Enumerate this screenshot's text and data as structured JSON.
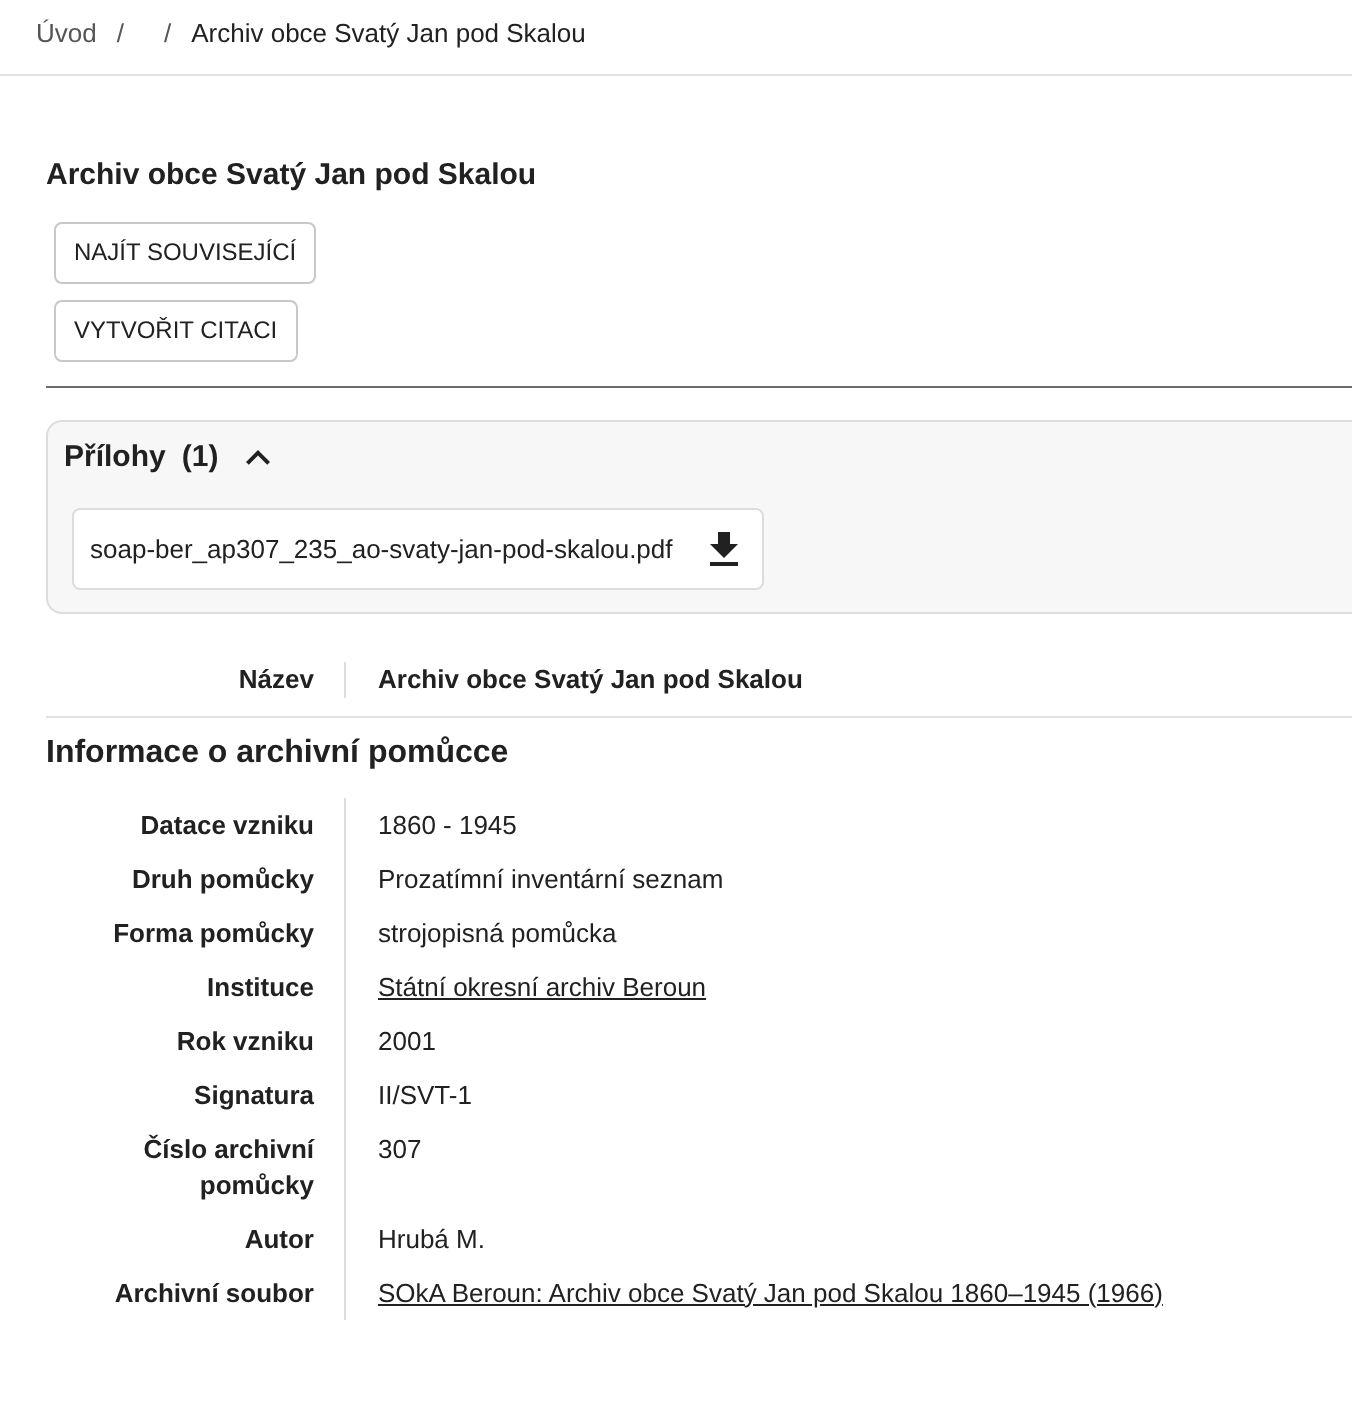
{
  "breadcrumb": [
    {
      "kind": "link",
      "text": "Úvod"
    },
    {
      "kind": "separator",
      "text": "/"
    },
    {
      "kind": "separator",
      "text": "/"
    },
    {
      "kind": "current",
      "text": "Archiv obce Svatý Jan pod Skalou"
    }
  ],
  "title": "Archiv obce Svatý Jan pod Skalou",
  "actions": [
    "NAJÍT SOUVISEJÍCÍ",
    "VYTVOŘIT CITACI"
  ],
  "attachments": {
    "title": "Přílohy",
    "count": "(1)",
    "expanded": true,
    "files": [
      {
        "name": "soap-ber_ap307_235_ao-svaty-jan-pod-skalou.pdf"
      }
    ]
  },
  "name_field": {
    "label": "Název",
    "value": "Archiv obce Svatý Jan pod Skalou"
  },
  "info": {
    "heading": "Informace o archivní pomůcce",
    "fields": [
      {
        "label": "Datace vzniku",
        "value": "1860 - 1945",
        "kind": "text"
      },
      {
        "label": "Druh pomůcky",
        "value": "Prozatímní inventární seznam",
        "kind": "text"
      },
      {
        "label": "Forma pomůcky",
        "value": "strojopisná pomůcka",
        "kind": "text"
      },
      {
        "label": "Instituce",
        "value": "Státní okresní archiv Beroun",
        "kind": "link"
      },
      {
        "label": "Rok vzniku",
        "value": "2001",
        "kind": "text"
      },
      {
        "label": "Signatura",
        "value": "II/SVT-1",
        "kind": "text"
      },
      {
        "label": "Číslo archivní pomůcky",
        "value": "307",
        "kind": "text"
      },
      {
        "label": "Autor",
        "value": "Hrubá M.",
        "kind": "text"
      },
      {
        "label": "Archivní soubor",
        "value": "SOkA Beroun: Archiv obce Svatý Jan pod Skalou 1860–1945 (1966)",
        "kind": "link"
      }
    ]
  }
}
